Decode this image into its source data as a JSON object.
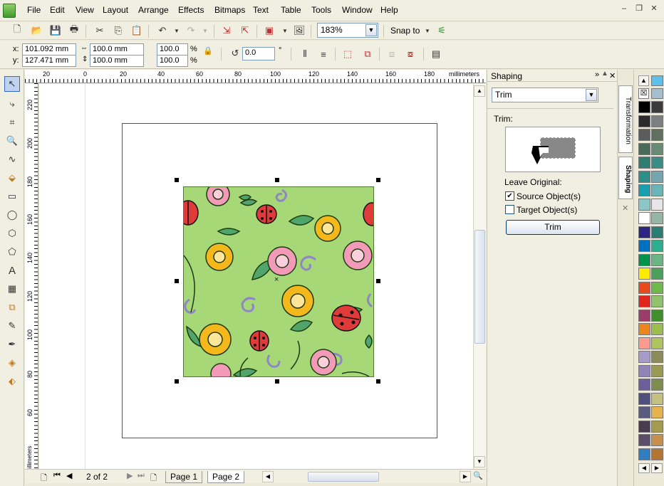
{
  "menu": [
    "File",
    "Edit",
    "View",
    "Layout",
    "Arrange",
    "Effects",
    "Bitmaps",
    "Text",
    "Table",
    "Tools",
    "Window",
    "Help"
  ],
  "toolbar": {
    "zoom_value": "183%",
    "snap_to_label": "Snap to"
  },
  "property_bar": {
    "x_label": "x:",
    "x_value": "101.092 mm",
    "y_label": "y:",
    "y_value": "127.471 mm",
    "width_value": "100.0 mm",
    "height_value": "100.0 mm",
    "scale_w_value": "100.0",
    "scale_h_value": "100.0",
    "percent_symbol": "%",
    "rotation_value": "0.0",
    "degree_symbol": "°"
  },
  "rulers": {
    "units": "millimeters",
    "top_ticks": [
      "20",
      "0",
      "20",
      "40",
      "60",
      "80",
      "100",
      "120",
      "140",
      "160",
      "180"
    ],
    "left_ticks": [
      "220",
      "200",
      "180",
      "160",
      "140",
      "120",
      "100",
      "80",
      "60"
    ]
  },
  "page_nav": {
    "page_count": "2 of 2",
    "tabs": [
      "Page 1",
      "Page 2"
    ],
    "active_tab": "Page 2"
  },
  "docker": {
    "title": "Shaping",
    "operation": "Trim",
    "section_label": "Trim:",
    "leave_original_label": "Leave Original:",
    "source_label": "Source Object(s)",
    "source_checked": true,
    "target_label": "Target Object(s)",
    "target_checked": false,
    "button_label": "Trim"
  },
  "dock_tabs": [
    "Transformation",
    "Shaping"
  ],
  "palette": {
    "colors": [
      "#000000",
      "#3b3b3b",
      "#2b2b2b",
      "#7c7f7f",
      "#5a5d5c",
      "#607060",
      "#4b6b5a",
      "#6a8a78",
      "#2e7f6f",
      "#3a8c87",
      "#2d8f8c",
      "#72a6b0",
      "#1a9faf",
      "#6bb5b9",
      "#8cc6c6",
      "#e6e6e6",
      "#ffffff",
      "#95b5a7",
      "#2d2483",
      "#2a7d73",
      "#0071c1",
      "#2cae8f",
      "#00934c",
      "#6ab582",
      "#ffeb00",
      "#4aa25a",
      "#e84a1b",
      "#6fb94a",
      "#e4251d",
      "#8fc46a",
      "#9b3d67",
      "#3f8f2a",
      "#ea861d",
      "#9bbf4d",
      "#ff9a8e",
      "#b0c45c",
      "#a89bc7",
      "#8c8c5b",
      "#8f83b7",
      "#9a9a55",
      "#6d5f9d",
      "#7d8d4d",
      "#4f4f7d",
      "#c4c07d",
      "#5b5a7f",
      "#e6b24e",
      "#483c4e",
      "#a59a4e",
      "#5b4d6a",
      "#c68f4d",
      "#2f7fbf",
      "#b5742f"
    ]
  }
}
